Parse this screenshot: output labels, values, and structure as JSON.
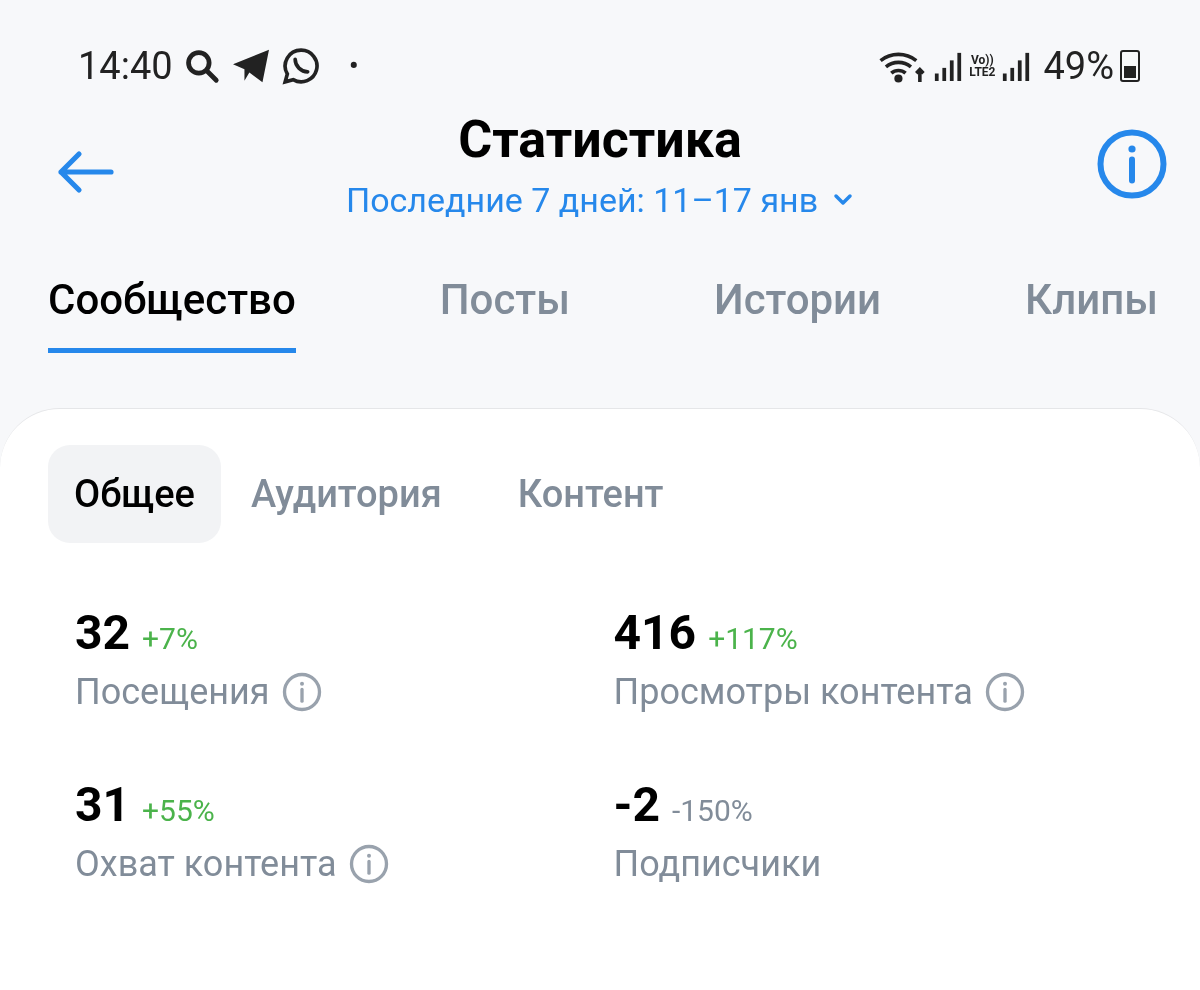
{
  "status_bar": {
    "time": "14:40",
    "dot": "•",
    "network_label_top": "Vo))",
    "network_label_bottom": "LTE2",
    "battery": "49%"
  },
  "header": {
    "title": "Статистика",
    "period": "Последние 7 дней: 11–17 янв"
  },
  "tabs": [
    {
      "label": "Сообщество",
      "selected": true
    },
    {
      "label": "Посты",
      "selected": false
    },
    {
      "label": "Истории",
      "selected": false
    },
    {
      "label": "Клипы",
      "selected": false
    }
  ],
  "segments": [
    {
      "label": "Общее",
      "selected": true
    },
    {
      "label": "Аудитория",
      "selected": false
    },
    {
      "label": "Контент",
      "selected": false
    }
  ],
  "stats": [
    {
      "value": "32",
      "change": "+7%",
      "color": "#4bb34b",
      "label": "Посещения",
      "info": true
    },
    {
      "value": "416",
      "change": "+117%",
      "color": "#4bb34b",
      "label": "Просмотры контента",
      "info": true
    },
    {
      "value": "31",
      "change": "+55%",
      "color": "#4bb34b",
      "label": "Охват контента",
      "info": true
    },
    {
      "value": "-2",
      "change": "-150%",
      "color": "#818c99",
      "label": "Подписчики",
      "info": false
    }
  ]
}
